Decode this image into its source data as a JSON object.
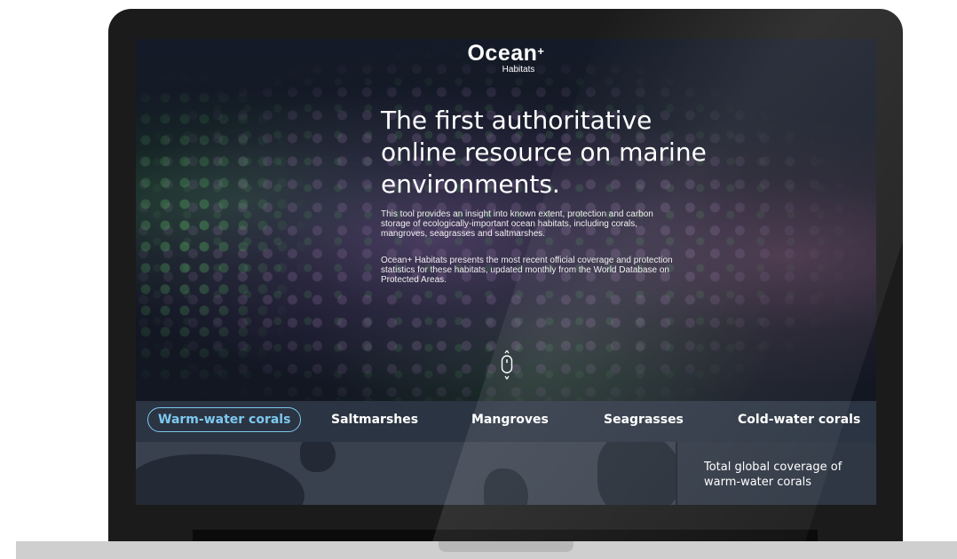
{
  "logo": {
    "name": "Ocean",
    "superscript": "+",
    "subtitle": "Habitats"
  },
  "hero": {
    "headline": "The first authoritative online resource on marine environments.",
    "paragraph1": "This tool provides an insight into known extent, protection and carbon storage of ecologically-important ocean habitats, including corals, mangroves, seagrasses and saltmarshes.",
    "paragraph2": "Ocean+ Habitats presents the most recent official coverage and protection statistics for these habitats, updated monthly from the World Database on Protected Areas."
  },
  "tabs": [
    {
      "label": "Warm-water corals",
      "active": true
    },
    {
      "label": "Saltmarshes",
      "active": false
    },
    {
      "label": "Mangroves",
      "active": false
    },
    {
      "label": "Seagrasses",
      "active": false
    },
    {
      "label": "Cold-water corals",
      "active": false
    }
  ],
  "side_panel": {
    "title": "Total global coverage of warm-water corals"
  },
  "colors": {
    "accent": "#7ec8ef",
    "tabbar": "#2b3442",
    "bezel": "#1b1b1b"
  },
  "icons": {
    "scroll": "mouse-scroll-icon"
  }
}
